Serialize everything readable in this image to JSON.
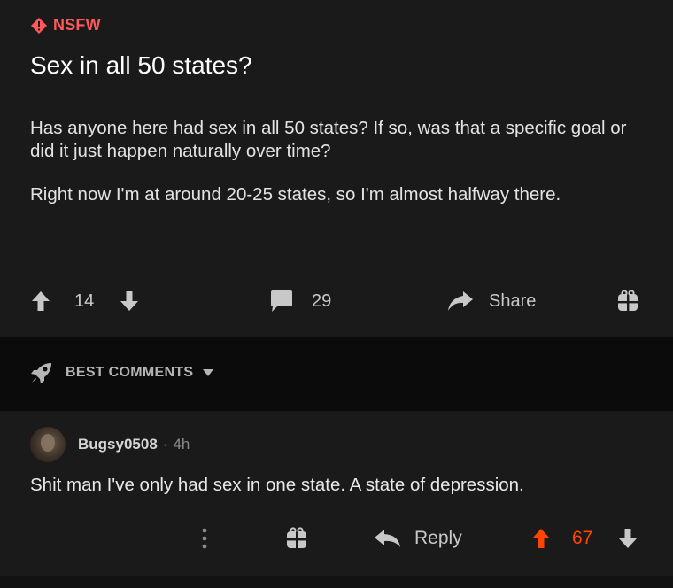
{
  "post": {
    "nsfw_label": "NSFW",
    "title": "Sex in all 50 states?",
    "body_1": "Has anyone here had sex in all 50 states?  If so, was that a specific goal or did it just happen naturally over time?",
    "body_2": "Right now I'm at around 20-25 states, so I'm almost halfway there.",
    "score": "14",
    "comments_count": "29",
    "share_label": "Share"
  },
  "sort": {
    "label": "BEST COMMENTS"
  },
  "comment": {
    "username": "Bugsy0508",
    "separator": "·",
    "age": "4h",
    "text": "Shit man I've only had sex in one state. A state of depression.",
    "reply_label": "Reply",
    "score": "67"
  },
  "colors": {
    "background": "#121212",
    "card": "#1a1a1b",
    "nsfw": "#ff585b",
    "upvoted": "#ff4500"
  }
}
